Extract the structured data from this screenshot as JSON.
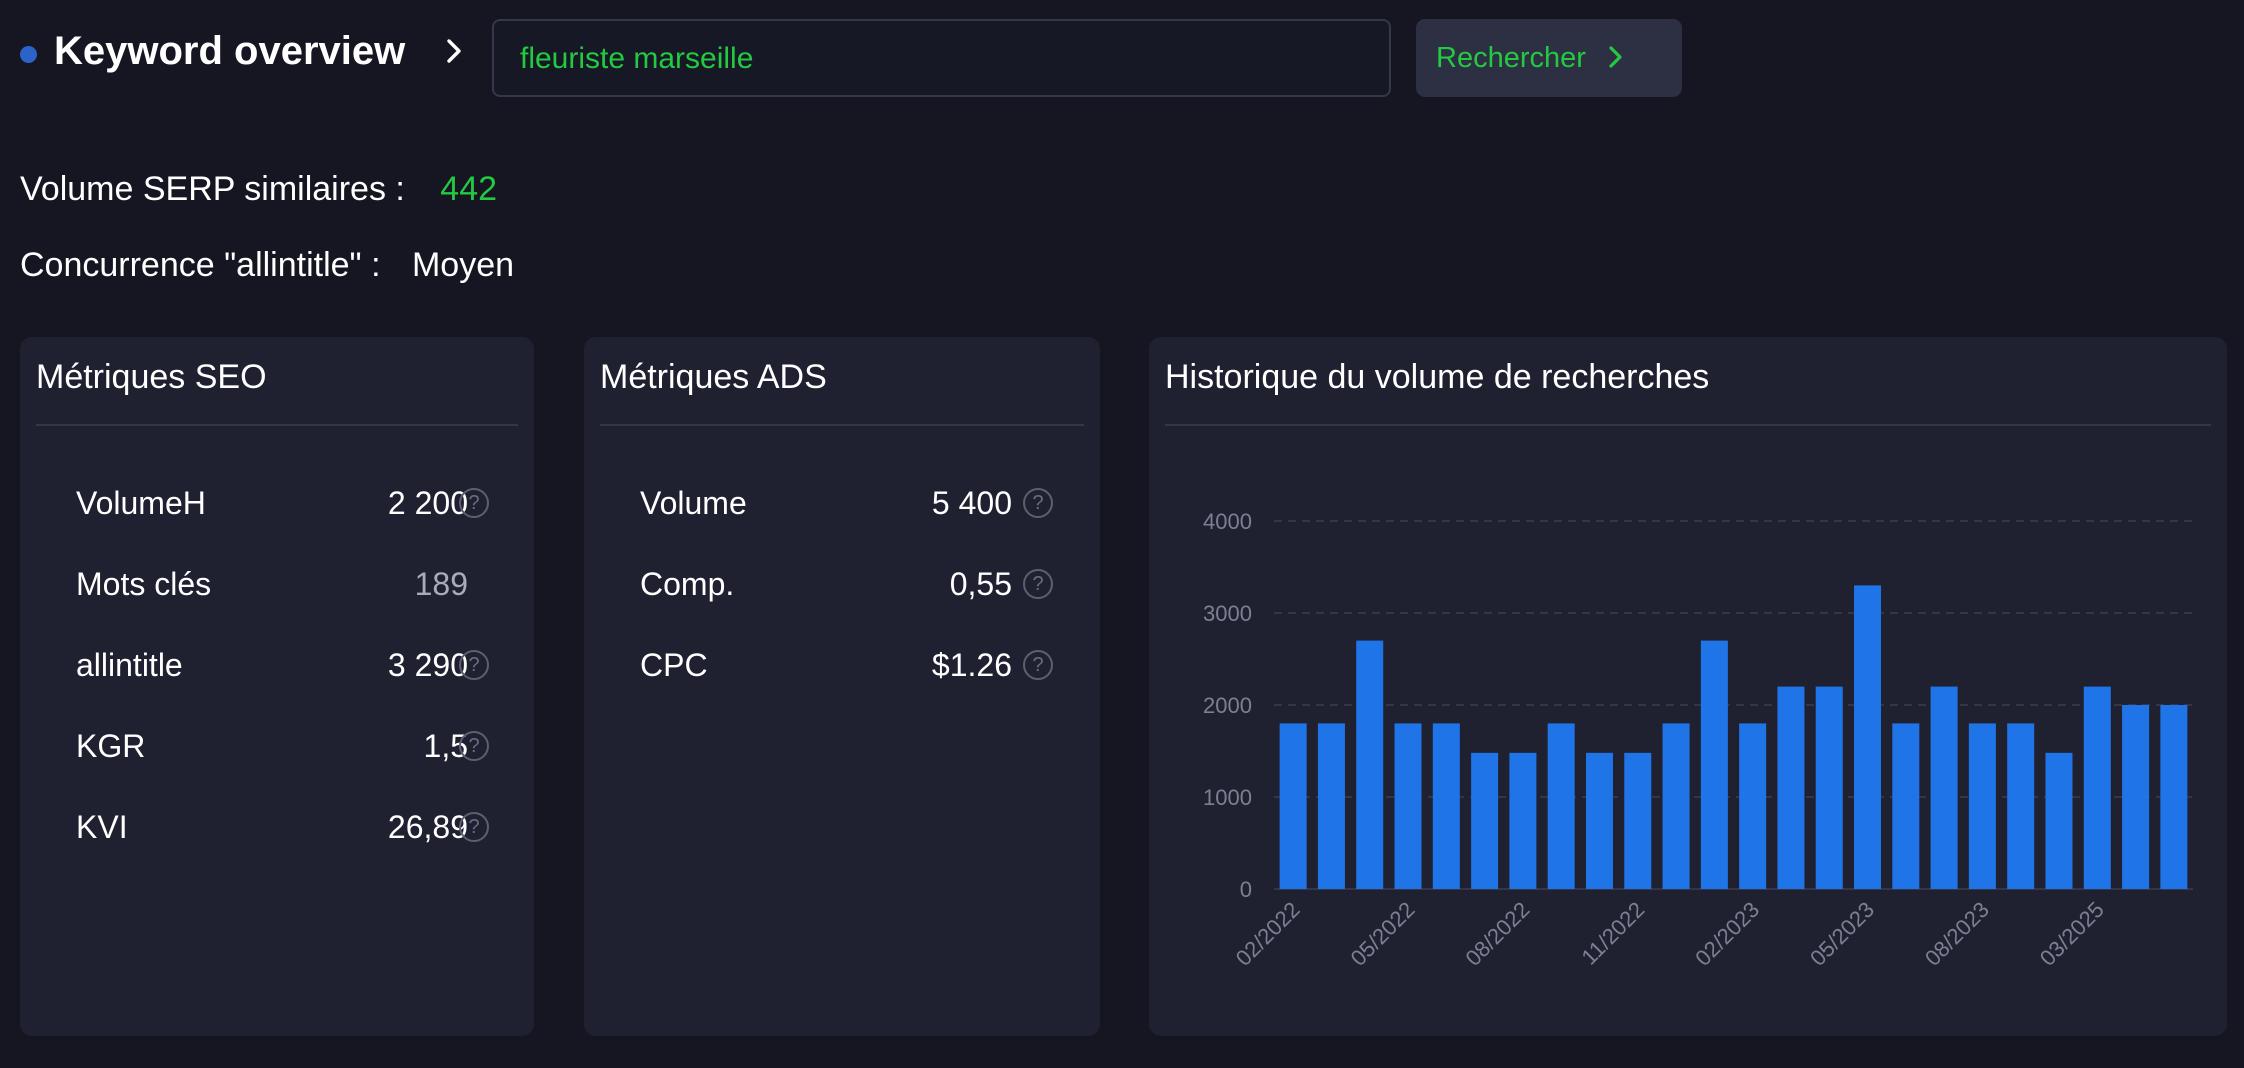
{
  "header": {
    "title": "Keyword overview",
    "search_value": "fleuriste marseille",
    "search_button_label": "Rechercher"
  },
  "summary": {
    "serp_label": "Volume SERP similaires :",
    "serp_value": "442",
    "competition_label": "Concurrence \"allintitle\" :",
    "competition_value": "Moyen"
  },
  "seo_card": {
    "title": "Métriques SEO",
    "metrics": [
      {
        "label": "VolumeH",
        "value": "2 200",
        "help": true
      },
      {
        "label": "Mots clés",
        "value": "189",
        "help": false
      },
      {
        "label": "allintitle",
        "value": "3 290",
        "help": true
      },
      {
        "label": "KGR",
        "value": "1,5",
        "help": true
      },
      {
        "label": "KVI",
        "value": "26,89",
        "help": true
      }
    ]
  },
  "ads_card": {
    "title": "Métriques ADS",
    "metrics": [
      {
        "label": "Volume",
        "value": "5 400",
        "help": true
      },
      {
        "label": "Comp.",
        "value": "0,55",
        "help": true
      },
      {
        "label": "CPC",
        "value": "$1.26",
        "help": true
      }
    ]
  },
  "history_card": {
    "title": "Historique du volume de recherches"
  },
  "colors": {
    "accent_green": "#23c940",
    "bar_blue": "#1f74e8",
    "dot_blue": "#2b63c8",
    "background": "#151622",
    "card": "#202130"
  },
  "icons": {
    "help": "question-circle-icon",
    "chevron": "chevron-right-icon"
  },
  "chart_data": {
    "type": "bar",
    "title": "Historique du volume de recherches",
    "ylim": [
      0,
      4000
    ],
    "yticks": [
      "0",
      "1000",
      "2000",
      "3000",
      "4000"
    ],
    "grid": true,
    "tick_labels": [
      "02/2022",
      "05/2022",
      "08/2022",
      "11/2022",
      "02/2023",
      "05/2023",
      "08/2023",
      "03/2025"
    ],
    "tick_bar_index": [
      0,
      3,
      6,
      9,
      12,
      15,
      18,
      21
    ],
    "values": [
      1800,
      1800,
      2700,
      1800,
      1800,
      1480,
      1480,
      1800,
      1480,
      1480,
      1800,
      2700,
      1800,
      2200,
      2200,
      3300,
      1800,
      2200,
      1800,
      1800,
      1480,
      2200,
      2000,
      2000
    ]
  }
}
